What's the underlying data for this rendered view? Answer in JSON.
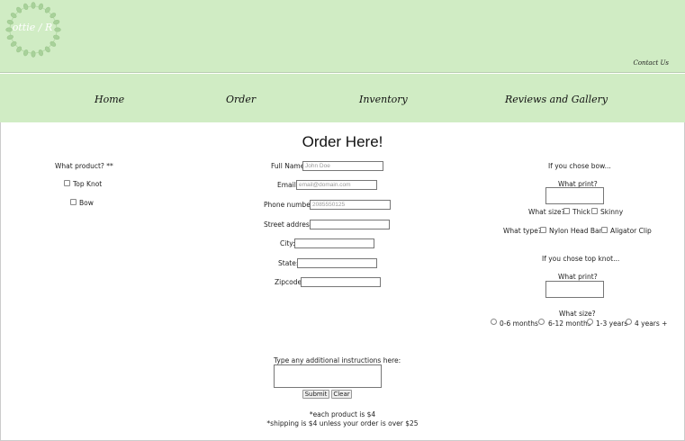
{
  "header": {
    "logo_text": "ottie / R",
    "contact_label": "Contact Us"
  },
  "nav": {
    "items": [
      {
        "label": "Home"
      },
      {
        "label": "Order"
      },
      {
        "label": "Inventory"
      },
      {
        "label": "Reviews and Gallery"
      }
    ]
  },
  "title": "Order Here!",
  "product": {
    "label": "What product? **",
    "options": [
      {
        "label": "Top Knot"
      },
      {
        "label": "Bow"
      }
    ]
  },
  "form": {
    "full_name": {
      "label": "Full Name:",
      "placeholder": "John Doe"
    },
    "email": {
      "label": "Email:",
      "placeholder": "email@domain.com"
    },
    "phone": {
      "label": "Phone number:",
      "placeholder": "2085550125"
    },
    "street": {
      "label": "Street address:",
      "placeholder": ""
    },
    "city": {
      "label": "City:",
      "placeholder": ""
    },
    "state": {
      "label": "State:",
      "placeholder": ""
    },
    "zipcode": {
      "label": "Zipcode:",
      "placeholder": ""
    }
  },
  "bow_section": {
    "heading": "If you chose bow...",
    "print_label": "What print?",
    "size_label": "What size?",
    "size_options": [
      {
        "label": "Thick"
      },
      {
        "label": "Skinny"
      }
    ],
    "type_label": "What type?",
    "type_options": [
      {
        "label": "Nylon Head Band"
      },
      {
        "label": "Aligator Clip"
      }
    ]
  },
  "topknot_section": {
    "heading": "If you chose top knot...",
    "print_label": "What print?",
    "size_label": "What size?",
    "size_options": [
      {
        "label": "0-6 months"
      },
      {
        "label": "6-12 months"
      },
      {
        "label": "1-3 years"
      },
      {
        "label": "4 years +"
      }
    ]
  },
  "instructions": {
    "label": "Type any additional instructions here:"
  },
  "buttons": {
    "submit": "Submit",
    "clear": "Clear"
  },
  "notes": {
    "product_price": "*each product is $4",
    "shipping": "*shipping is $4 unless your order is over $25"
  },
  "colors": {
    "header_bg": "#d0ecc4",
    "logo_wreath": "#a8d19a"
  }
}
